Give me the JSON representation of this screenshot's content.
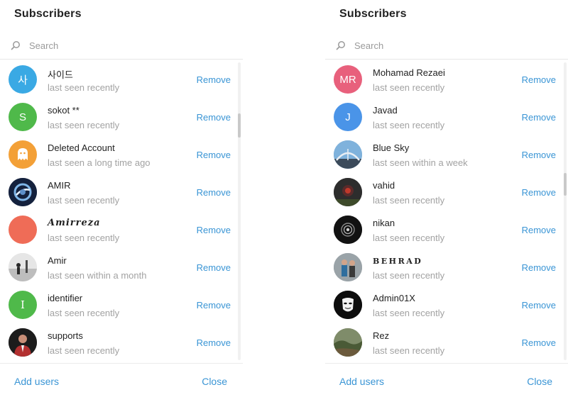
{
  "colors": {
    "accent": "#3a95d5",
    "status_text": "#a2a2a2",
    "name_text": "#222222"
  },
  "left": {
    "title": "Subscribers",
    "search_placeholder": "Search",
    "remove_label": "Remove",
    "add_users_label": "Add users",
    "close_label": "Close",
    "items": [
      {
        "name": "사이드",
        "status": "last seen recently",
        "avatar_text": "사",
        "avatar_color": "#3aa9e4"
      },
      {
        "name": "sokot **",
        "status": "last seen recently",
        "avatar_text": "S",
        "avatar_color": "#4fb94a"
      },
      {
        "name": "Deleted Account",
        "status": "last seen a long time ago",
        "avatar_text": "",
        "avatar_color": "#f3a037"
      },
      {
        "name": "AMIR",
        "status": "last seen recently",
        "avatar_text": "",
        "avatar_color": "#1b2a47"
      },
      {
        "name": "Amirreza",
        "status": "last seen recently",
        "avatar_text": "",
        "avatar_color": "#ef6c57"
      },
      {
        "name": "Amir",
        "status": "last seen within a month",
        "avatar_text": "",
        "avatar_color": "#d9d9d9"
      },
      {
        "name": "identifier",
        "status": "last seen recently",
        "avatar_text": "I",
        "avatar_color": "#4fb94a"
      },
      {
        "name": "supports",
        "status": "last seen recently",
        "avatar_text": "",
        "avatar_color": "#1a1a1a"
      }
    ]
  },
  "right": {
    "title": "Subscribers",
    "search_placeholder": "Search",
    "remove_label": "Remove",
    "add_users_label": "Add users",
    "close_label": "Close",
    "items": [
      {
        "name": "Mohamad Rezaei",
        "status": "last seen recently",
        "avatar_text": "MR",
        "avatar_color": "#e8607c"
      },
      {
        "name": "Javad",
        "status": "last seen recently",
        "avatar_text": "J",
        "avatar_color": "#4a94e8"
      },
      {
        "name": "Blue Sky",
        "status": "last seen within a week",
        "avatar_text": "",
        "avatar_color": "#5b8fb9"
      },
      {
        "name": "vahid",
        "status": "last seen recently",
        "avatar_text": "",
        "avatar_color": "#2b2b2b"
      },
      {
        "name": "nikan",
        "status": "last seen recently",
        "avatar_text": "",
        "avatar_color": "#141414"
      },
      {
        "name": "BEHRAD",
        "status": "last seen recently",
        "avatar_text": "",
        "avatar_color": "#8a8f93"
      },
      {
        "name": "Admin01X",
        "status": "last seen recently",
        "avatar_text": "",
        "avatar_color": "#0f0f0f"
      },
      {
        "name": "Rez",
        "status": "last seen recently",
        "avatar_text": "",
        "avatar_color": "#5d6b45"
      }
    ]
  }
}
